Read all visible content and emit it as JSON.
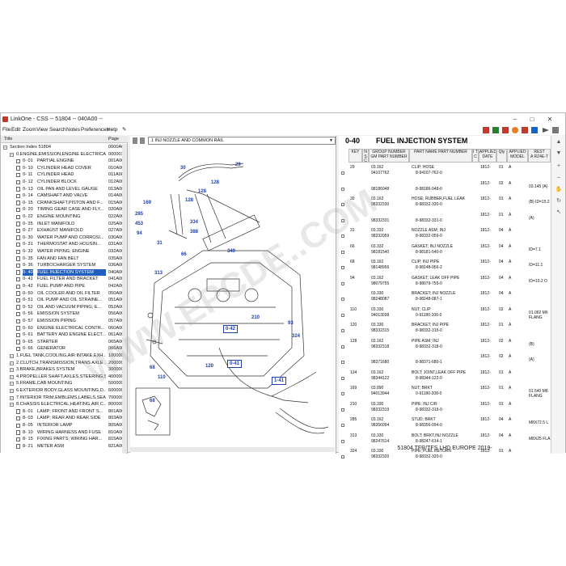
{
  "window": {
    "title": "LinkOne - CSS -- 51804 -- 040A00 --",
    "controls": [
      "–",
      "□",
      "✕"
    ]
  },
  "menu": [
    "File",
    "Edit",
    "Zoom",
    "View",
    "Search",
    "Notes",
    "Preferences",
    "Help",
    "✎"
  ],
  "tree": {
    "col_title": "Title",
    "col_page": "Page",
    "rows": [
      {
        "indent": 0,
        "kind": "exp",
        "code": "",
        "label": "Section Index 51804",
        "page": "0000A0"
      },
      {
        "indent": 1,
        "kind": "exp",
        "code": "",
        "label": "0.ENGINE,EMISSION,ENGINE ELECTRICA...",
        "page": "000001"
      },
      {
        "indent": 2,
        "kind": "doc",
        "code": "0- 01",
        "label": "PARTIAL ENGINE",
        "page": "001A00"
      },
      {
        "indent": 2,
        "kind": "doc",
        "code": "0- 10",
        "label": "CYLINDER HEAD COVER",
        "page": "010A00"
      },
      {
        "indent": 2,
        "kind": "doc",
        "code": "0- 11",
        "label": "CYLINDER HEAD",
        "page": "011A00"
      },
      {
        "indent": 2,
        "kind": "doc",
        "code": "0- 12",
        "label": "CYLINDER BLOCK",
        "page": "012A00"
      },
      {
        "indent": 2,
        "kind": "doc",
        "code": "0- 13",
        "label": "OIL PAN AND LEVEL GAUGE",
        "page": "013A00"
      },
      {
        "indent": 2,
        "kind": "doc",
        "code": "0- 14",
        "label": "CAMSHAFT AND VALVE",
        "page": "014A00"
      },
      {
        "indent": 2,
        "kind": "doc",
        "code": "0- 15",
        "label": "CRANKSHAFT,PISTON AND F...",
        "page": "015A00"
      },
      {
        "indent": 2,
        "kind": "doc",
        "code": "0- 20",
        "label": "TIMING GEAR CASE AND FLY...",
        "page": "020A00"
      },
      {
        "indent": 2,
        "kind": "doc",
        "code": "0- 22",
        "label": "ENGINE MOUNTING",
        "page": "022A00"
      },
      {
        "indent": 2,
        "kind": "doc",
        "code": "0- 25",
        "label": "INLET MANIFOLD",
        "page": "025A00"
      },
      {
        "indent": 2,
        "kind": "doc",
        "code": "0- 27",
        "label": "EXHAUST MANIFOLD",
        "page": "027A00"
      },
      {
        "indent": 2,
        "kind": "doc",
        "code": "0- 30",
        "label": "WATER PUMP AND CORROSI...",
        "page": "030A00"
      },
      {
        "indent": 2,
        "kind": "doc",
        "code": "0- 31",
        "label": "THERMOSTAT AND HOUSIN...",
        "page": "031A00"
      },
      {
        "indent": 2,
        "kind": "doc",
        "code": "0- 32",
        "label": "WATER PIPING; ENGINE",
        "page": "032A00"
      },
      {
        "indent": 2,
        "kind": "doc",
        "code": "0- 35",
        "label": "FAN AND FAN BELT",
        "page": "035A00"
      },
      {
        "indent": 2,
        "kind": "doc",
        "code": "0- 36",
        "label": "TURBOCHARGER SYSTEM",
        "page": "036A00"
      },
      {
        "indent": 2,
        "kind": "doc",
        "code": "0- 40",
        "label": "FUEL INJECTION SYSTEM",
        "page": "040A00",
        "selected": true
      },
      {
        "indent": 2,
        "kind": "doc",
        "code": "0- 41",
        "label": "FUEL FILTER AND BRACKET",
        "page": "041A00"
      },
      {
        "indent": 2,
        "kind": "doc",
        "code": "0- 42",
        "label": "FUEL PUMP AND PIPE",
        "page": "042A00"
      },
      {
        "indent": 2,
        "kind": "doc",
        "code": "0- 50",
        "label": "OIL COOLER AND OIL FILTER",
        "page": "050A00"
      },
      {
        "indent": 2,
        "kind": "doc",
        "code": "0- 51",
        "label": "OIL PUMP AND OIL STRAINE...",
        "page": "051A00"
      },
      {
        "indent": 2,
        "kind": "doc",
        "code": "0- 52",
        "label": "OIL AND VACUUM PIPING; E...",
        "page": "052A00"
      },
      {
        "indent": 2,
        "kind": "doc",
        "code": "0- 56",
        "label": "EMISSION SYSTEM",
        "page": "056A00"
      },
      {
        "indent": 2,
        "kind": "doc",
        "code": "0- 57",
        "label": "EMISSION PIPING",
        "page": "057A00"
      },
      {
        "indent": 2,
        "kind": "doc",
        "code": "0- 60",
        "label": "ENGINE ELECTRICAL CONTR...",
        "page": "060A00"
      },
      {
        "indent": 2,
        "kind": "doc",
        "code": "0- 61",
        "label": "BATTERY AND ENGINE ELECT...",
        "page": "061A00"
      },
      {
        "indent": 2,
        "kind": "doc",
        "code": "0- 65",
        "label": "STARTER",
        "page": "065A00"
      },
      {
        "indent": 2,
        "kind": "doc",
        "code": "0- 66",
        "label": "GENERATOR",
        "page": "066A00"
      },
      {
        "indent": 1,
        "kind": "exp",
        "code": "",
        "label": "1.FUEL TANK,COOLING,AIR INTAKE,EXH...",
        "page": "100000"
      },
      {
        "indent": 1,
        "kind": "exp",
        "code": "",
        "label": "2.CLUTCH,TRANSMISSION,TRANS AXLE ...",
        "page": "200000"
      },
      {
        "indent": 1,
        "kind": "exp",
        "code": "",
        "label": "3.BRAKE,BRAKES SYSTEM",
        "page": "300000"
      },
      {
        "indent": 1,
        "kind": "exp",
        "code": "",
        "label": "4.PROPELLER SHAFT,AXLES,STEERING,S...",
        "page": "400000"
      },
      {
        "indent": 1,
        "kind": "exp",
        "code": "",
        "label": "5.FRAME,CAB MOUNTING",
        "page": "500000"
      },
      {
        "indent": 1,
        "kind": "exp",
        "code": "",
        "label": "6.EXTERIOR BODY,GLASS MOUNTING,D...",
        "page": "600000"
      },
      {
        "indent": 1,
        "kind": "exp",
        "code": "",
        "label": "7.INTERIOR TRIM,EMBLEMS,LABELS,SEA...",
        "page": "700000"
      },
      {
        "indent": 1,
        "kind": "exp",
        "code": "",
        "label": "8.CHASSIS ELECTRICAL,HEATING,AIR C...",
        "page": "800000"
      },
      {
        "indent": 2,
        "kind": "doc",
        "code": "8- 01",
        "label": "LAMP; FRONT AND FRONT S...",
        "page": "801A00"
      },
      {
        "indent": 2,
        "kind": "doc",
        "code": "8- 03",
        "label": "LAMP; REAR AND REAR SIDE",
        "page": "803A00"
      },
      {
        "indent": 2,
        "kind": "doc",
        "code": "8- 05",
        "label": "INTERIOR LAMP",
        "page": "805A00"
      },
      {
        "indent": 2,
        "kind": "doc",
        "code": "8- 10",
        "label": "WIRING HARNESS AND FUSE",
        "page": "810A00"
      },
      {
        "indent": 2,
        "kind": "doc",
        "code": "8- 15",
        "label": "FIXING PARTS; WIRING HAR...",
        "page": "815A00"
      },
      {
        "indent": 2,
        "kind": "doc",
        "code": "8- 21",
        "label": "METER ASM",
        "page": "821A00"
      }
    ]
  },
  "diagram": {
    "view_select": "1 INJ NOZZLE AND COMMON RAIL",
    "callouts": [
      "30",
      "29",
      "128",
      "128",
      "128",
      "169",
      "285",
      "453",
      "94",
      "334",
      "388",
      "31",
      "66",
      "349",
      "313",
      "93",
      "324",
      "210",
      "120",
      "68",
      "110",
      "68"
    ],
    "boxed_callouts": [
      "0-42",
      "0-41",
      "1-41"
    ]
  },
  "parts": {
    "section_code": "0-40",
    "section_title": "FUEL INJECTION SYSTEM",
    "columns": [
      "KEY",
      "N S C",
      "GROUP NUMBER GM PART NUMBER",
      "PART NAME PART NUMBER",
      "I T C",
      "APPLIED DATE",
      "Qty",
      "APPLIED MODEL",
      "REST"
    ],
    "rest_sub": "A RZ4E-T",
    "rows": [
      {
        "key": "29",
        "grp": "03.162",
        "gm": "94107762",
        "name": "CLIP; HOSE",
        "pn": "8-94107-762-0",
        "date": "1812-",
        "qty": "01",
        "m": "A",
        "rest": ""
      },
      {
        "key": "",
        "grp": "",
        "gm": "98186048",
        "name": "",
        "pn": "8-98186-048-0",
        "date": "1812-",
        "qty": "02",
        "m": "A",
        "rest": "03.145 (A)"
      },
      {
        "key": "30",
        "grp": "03.163",
        "gm": "98332330",
        "name": "HOSE; RUBBER,FUEL LEAK",
        "pn": "8-98332-330-0",
        "date": "1812-",
        "qty": "01",
        "m": "A",
        "rest": "(B) ID=15.2"
      },
      {
        "key": "",
        "grp": "",
        "gm": "98332331",
        "name": "",
        "pn": "8-98332-331-0",
        "date": "1812-",
        "qty": "01",
        "m": "A",
        "rest": "(A)"
      },
      {
        "key": "31",
        "grp": "03.332",
        "gm": "98332059",
        "name": "NOZZLE ASM; INJ",
        "pn": "8-98332-059-0",
        "date": "1812-",
        "qty": "04",
        "m": "A",
        "rest": ""
      },
      {
        "key": "66",
        "grp": "03.332",
        "gm": "98181540",
        "name": "GASKET; INJ NOZZLE",
        "pn": "8-98181-540-0",
        "date": "1812-",
        "qty": "04",
        "m": "A",
        "rest": "ID=7.1"
      },
      {
        "key": "68",
        "grp": "03.162",
        "gm": "98148956",
        "name": "CLIP; INJ PIPE",
        "pn": "8-98148-956-2",
        "date": "1812-",
        "qty": "04",
        "m": "A",
        "rest": "ID=11.1"
      },
      {
        "key": "94",
        "grp": "03.162",
        "gm": "98079755",
        "name": "GASKET; LEAK OFF PIPE",
        "pn": "8-98079-755-0",
        "date": "1812-",
        "qty": "04",
        "m": "A",
        "rest": "ID=10.2 O"
      },
      {
        "key": "",
        "grp": "03.330",
        "gm": "98248087",
        "name": "BRACKET; INJ NOZZLE",
        "pn": "8-98248-087-1",
        "date": "1812-",
        "qty": "04",
        "m": "A",
        "rest": ""
      },
      {
        "key": "110",
        "grp": "03.330",
        "gm": "94013038",
        "name": "NUT; CLIP",
        "pn": "0-91180-106-0",
        "date": "1812-",
        "qty": "02",
        "m": "A",
        "rest": "01.062 M6 FLANG"
      },
      {
        "key": "120",
        "grp": "03.330",
        "gm": "98332315",
        "name": "BRACKET; INJ PIPE",
        "pn": "8-98332-315-0",
        "date": "1812-",
        "qty": "01",
        "m": "A",
        "rest": ""
      },
      {
        "key": "128",
        "grp": "03.162",
        "gm": "98332318",
        "name": "PIPE ASM; INJ",
        "pn": "8-98332-318-0",
        "date": "1812-",
        "qty": "02",
        "m": "A",
        "rest": "(B)"
      },
      {
        "key": "",
        "grp": "",
        "gm": "98371680",
        "name": "",
        "pn": "8-98371-680-1",
        "date": "1812-",
        "qty": "02",
        "m": "A",
        "rest": "(A)"
      },
      {
        "key": "134",
        "grp": "03.162",
        "gm": "98344122",
        "name": "BOLT; JOINT,LEAK OFF PIPE",
        "pn": "8-98344-122-0",
        "date": "1812-",
        "qty": "01",
        "m": "A",
        "rest": ""
      },
      {
        "key": "169",
        "grp": "03.890",
        "gm": "94013944",
        "name": "NUT; BRKT",
        "pn": "0-91180-208-0",
        "date": "1812-",
        "qty": "01",
        "m": "A",
        "rest": "01.540 M8 FLANG"
      },
      {
        "key": "210",
        "grp": "03.330",
        "gm": "98332319",
        "name": "PIPE; INJ C/R",
        "pn": "8-98332-319-0",
        "date": "1812-",
        "qty": "01",
        "m": "A",
        "rest": ""
      },
      {
        "key": "285",
        "grp": "03.162",
        "gm": "98356094",
        "name": "STUD; BRKT",
        "pn": "8-98356-094-0",
        "date": "1812-",
        "qty": "04",
        "m": "A",
        "rest": "M8X72.5 L"
      },
      {
        "key": "313",
        "grp": "03.330",
        "gm": "98247614",
        "name": "BOLT; BRKT,INJ NOZZLE",
        "pn": "8-98247-614-1",
        "date": "1812-",
        "qty": "04",
        "m": "A",
        "rest": "M8X25 FLA"
      },
      {
        "key": "324",
        "grp": "03.330",
        "gm": "98332320",
        "name": "PIPE; FUEL RETURN",
        "pn": "8-98332-320-0",
        "date": "1812-",
        "qty": "01",
        "m": "A",
        "rest": ""
      }
    ],
    "footer": "51804 TFR/TFS LHD EUROPE 2019-"
  },
  "watermark": "WWW.EPCDE..COM",
  "colors": {
    "accent": "#1f5fbf",
    "callout": "#1e3ea8",
    "toolbar_red": "#c0392b"
  }
}
